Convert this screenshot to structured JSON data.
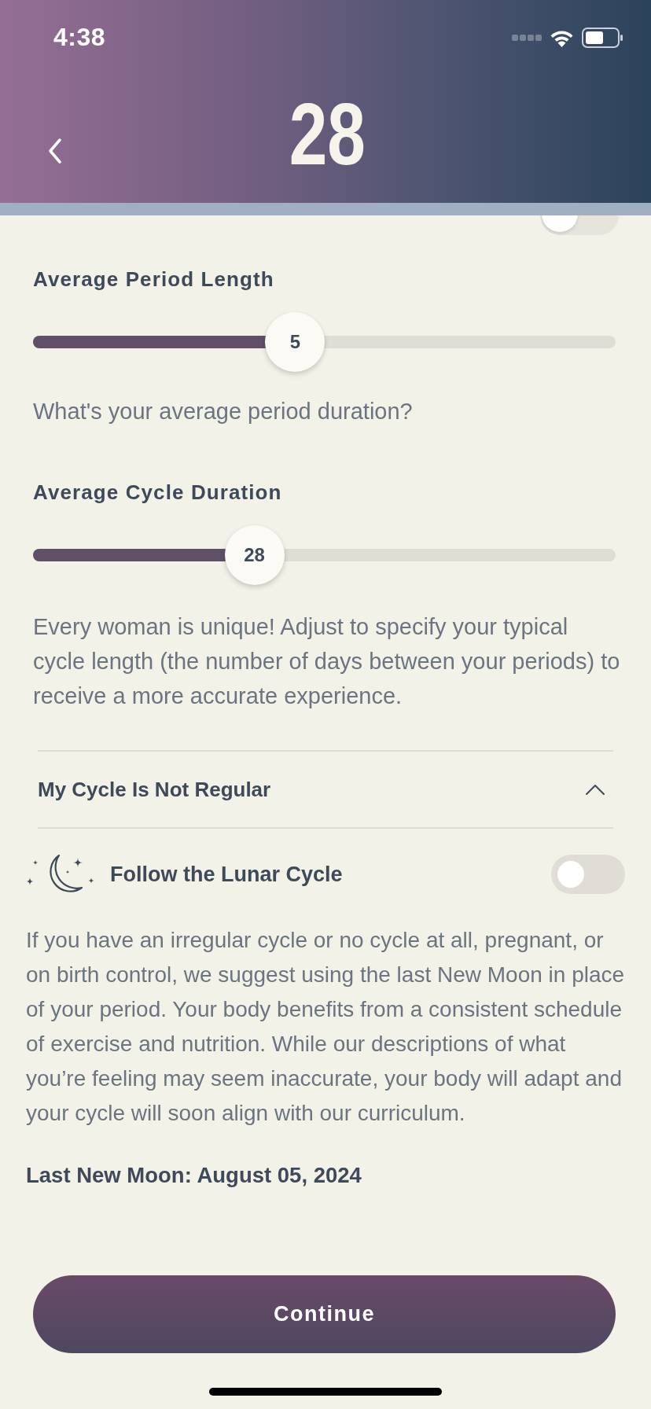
{
  "status_bar": {
    "time": "4:38"
  },
  "header": {
    "logo": "28"
  },
  "hidden_row": {
    "on": false
  },
  "sliders": [
    {
      "title": "Average Period Length",
      "value": "5",
      "level": 0.45,
      "hint": "What's your average period duration?"
    },
    {
      "title": "Average Cycle Duration",
      "value": "28",
      "level": 0.38,
      "hint": "Every woman is unique! Adjust to specify your typical cycle length (the number of days between your periods) to receive a more accurate experience."
    }
  ],
  "irregular_section": {
    "title": "My Cycle Is Not Regular",
    "expanded": true,
    "lunar_toggle": {
      "label": "Follow the Lunar Cycle",
      "on": false
    },
    "description": "If you have an irregular cycle or no cycle at all, pregnant, or on birth control, we suggest using the last New Moon in place of your period. Your body benefits from a consistent schedule of exercise and nutrition. While our descriptions of what you’re feeling may seem inaccurate, your body will adapt and your cycle will soon align with our curriculum.",
    "last_new_moon": "Last New Moon: August 05, 2024"
  },
  "continue_button": {
    "label": "Continue"
  }
}
